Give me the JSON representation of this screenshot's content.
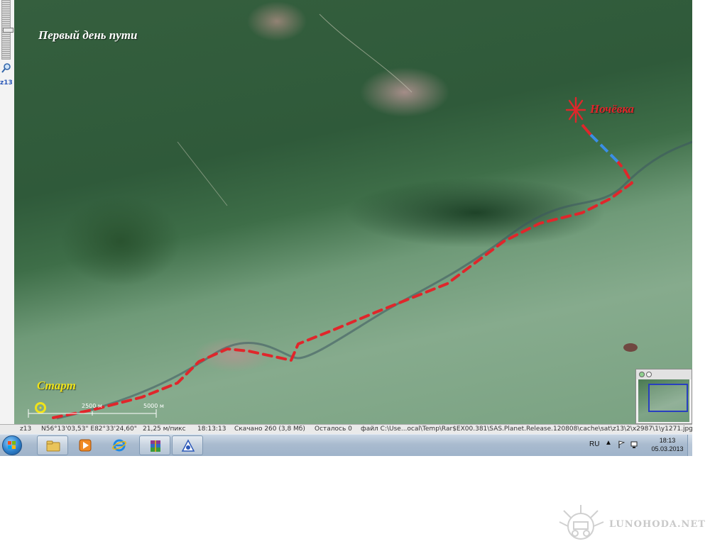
{
  "zoom_panel": {
    "level_label": "z13"
  },
  "map": {
    "title": "Первый день пути",
    "start_label": "Старт",
    "overnight_label": "Ночёвка",
    "scale": {
      "label_1": "2500 м",
      "label_2": "5000 м"
    },
    "route_color": "#e0262b",
    "route_last_segment_color": "#3a8ee6",
    "start_marker_color": "#f0e31a"
  },
  "status_bar": {
    "zoom": "z13",
    "coordinates": "N56°13'03,53\" E82°33'24,60\"",
    "resolution": "21,25 м/пикс",
    "time": "18:13:13",
    "downloaded": "Скачано 260 (3,8 Мб)",
    "remaining": "Осталось 0",
    "file": "файл C:\\Use...ocal\\Temp\\Rar$EX00.381\\SAS.Planet.Release.120808\\cache\\sat\\z13\\2\\x2987\\1\\y1271.jpg"
  },
  "taskbar": {
    "apps": [
      {
        "icon": "folder-icon"
      },
      {
        "icon": "media-player-icon"
      },
      {
        "icon": "internet-explorer-icon"
      },
      {
        "icon": "winrar-icon"
      },
      {
        "icon": "sas-planet-icon"
      }
    ],
    "tray": {
      "language": "RU",
      "time": "18:13",
      "date": "05.03.2013"
    }
  },
  "watermark": {
    "text": "LUNOHODA.NET"
  }
}
